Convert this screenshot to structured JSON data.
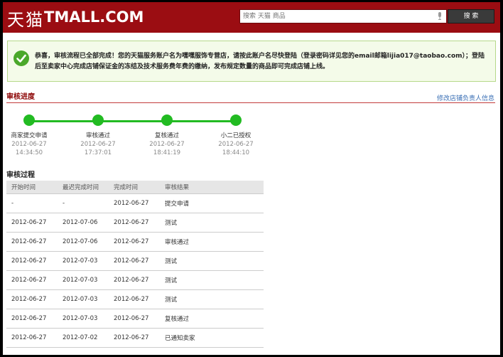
{
  "header": {
    "logo_cn": "天猫",
    "logo_en": "TMALL.COM",
    "search_placeholder": "搜索 天猫 商品",
    "search_button": "搜 索"
  },
  "notice": {
    "text": "恭喜，审核流程已全部完成！您的天猫服务账户名为嘿嘿服饰专营店，请按此账户名尽快登陆（登录密码详见您的email邮箱lijia017@taobao.com）；登陆后至卖家中心完成店铺保证金的冻结及技术服务费年费的缴纳，发布规定数量的商品即可完成店铺上线。"
  },
  "progress_section": {
    "title": "审核进度",
    "link": "修改店铺负责人信息",
    "steps": [
      {
        "label": "商家提交申请",
        "date": "2012-06-27",
        "time": "14:34:50"
      },
      {
        "label": "审核通过",
        "date": "2012-06-27",
        "time": "17:37:01"
      },
      {
        "label": "复核通过",
        "date": "2012-06-27",
        "time": "18:41:19"
      },
      {
        "label": "小二已授权",
        "date": "2012-06-27",
        "time": "18:44:10"
      }
    ]
  },
  "process_section": {
    "title": "审核过程",
    "columns": [
      "开始时间",
      "最迟完成时间",
      "完成时间",
      "审核结果"
    ],
    "rows": [
      [
        "-",
        "-",
        "2012-06-27",
        "提交申请"
      ],
      [
        "2012-06-27",
        "2012-07-06",
        "2012-06-27",
        "测试"
      ],
      [
        "2012-06-27",
        "2012-07-06",
        "2012-06-27",
        "审核通过"
      ],
      [
        "2012-06-27",
        "2012-07-03",
        "2012-06-27",
        "测试"
      ],
      [
        "2012-06-27",
        "2012-07-03",
        "2012-06-27",
        "测试"
      ],
      [
        "2012-06-27",
        "2012-07-03",
        "2012-06-27",
        "测试"
      ],
      [
        "2012-06-27",
        "2012-07-03",
        "2012-06-27",
        "复核通过"
      ],
      [
        "2012-06-27",
        "2012-07-02",
        "2012-06-27",
        "已通知卖家"
      ]
    ]
  },
  "colors": {
    "header_bg": "#9b0d12",
    "progress_green": "#22bb22",
    "section_title": "#8a0000",
    "link": "#3a6fb5"
  }
}
